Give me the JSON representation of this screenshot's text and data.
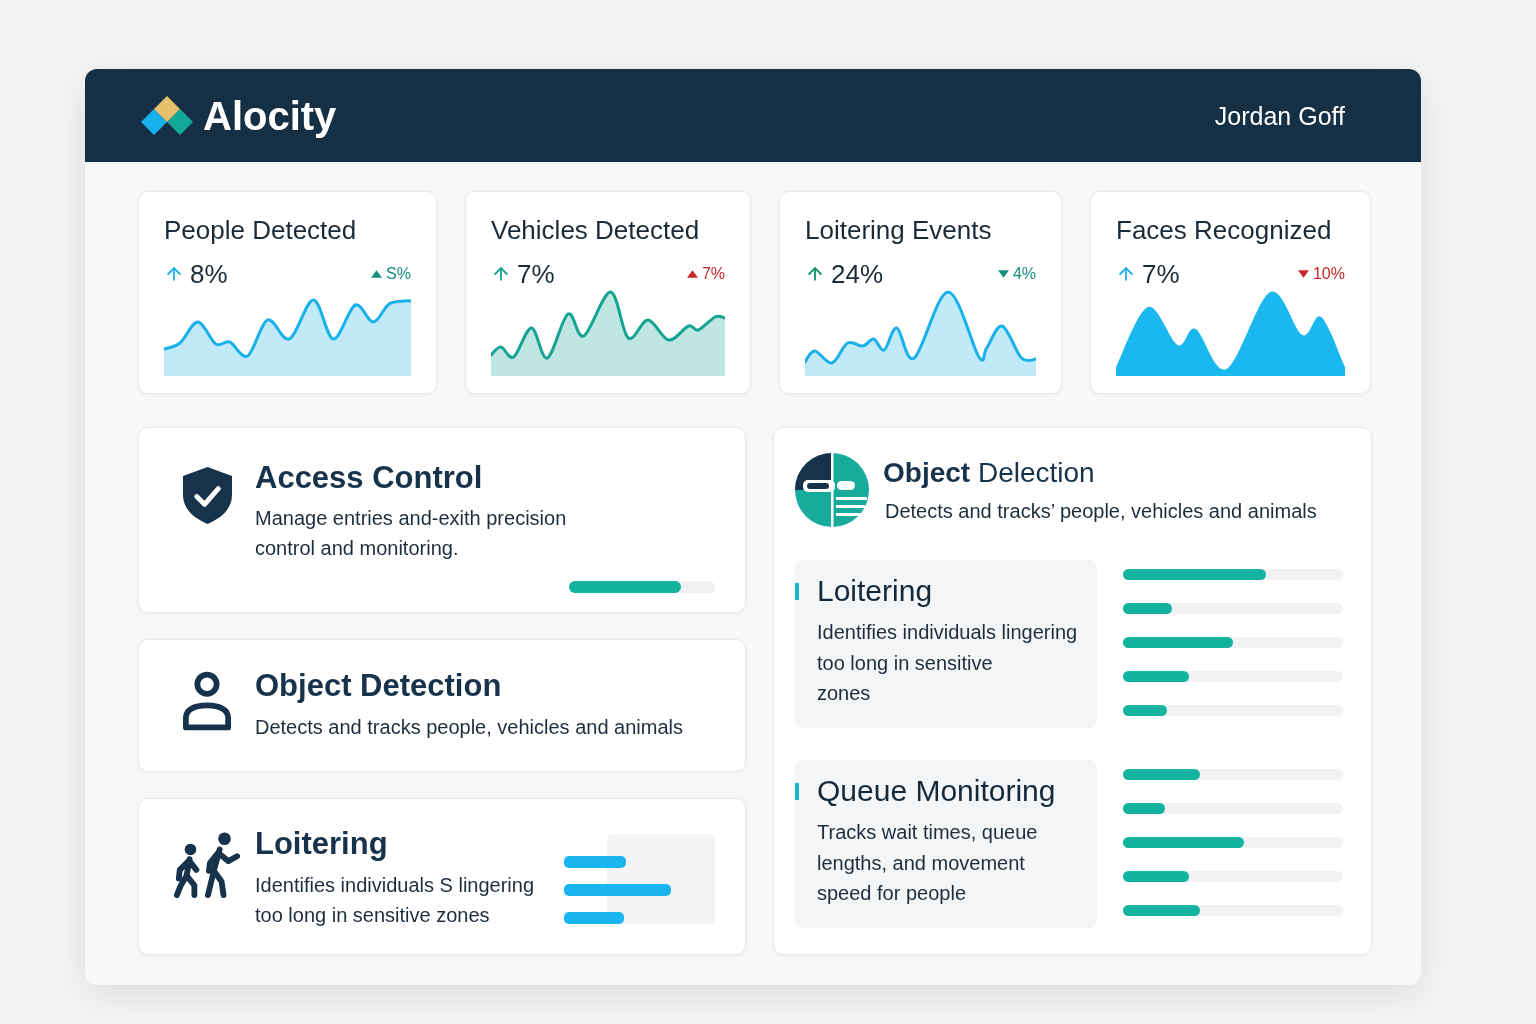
{
  "header": {
    "brand": "Alocity",
    "user_name": "Jordan Goff"
  },
  "stats": [
    {
      "title": "People Detected",
      "trend": {
        "value": "8%",
        "color": "#1ab1ea"
      },
      "change": {
        "text": "S%",
        "rising": true,
        "color": "#138f7e"
      },
      "chart": {
        "kind": "line",
        "color": "#1ab1ea"
      }
    },
    {
      "title": "Vehicles Detected",
      "trend": {
        "value": "7%",
        "color": "#17a392"
      },
      "change": {
        "text": "7%",
        "rising": true,
        "color": "#c62828"
      },
      "chart": {
        "kind": "line",
        "color": "#17a392"
      }
    },
    {
      "title": "Loitering Events",
      "trend": {
        "value": "24%",
        "color": "#138f6f"
      },
      "change": {
        "text": "4%",
        "rising": false,
        "color": "#138f7e"
      },
      "chart": {
        "kind": "line",
        "color": "#1ab1ea"
      }
    },
    {
      "title": "Faces Recognized",
      "trend": {
        "value": "7%",
        "color": "#1ab1ea"
      },
      "change": {
        "text": "10%",
        "rising": false,
        "color": "#c62828"
      },
      "chart": {
        "kind": "solid",
        "color": "#1bb8ef"
      }
    }
  ],
  "features": [
    {
      "kind": "progress",
      "title": "Access Control",
      "description": "Manage entries and-exith precision\ncontrol and monitoring.",
      "level": 0.77
    },
    {
      "kind": "plain",
      "title": "Object Detection",
      "description": "Detects and tracks people, vehicles and animals"
    },
    {
      "kind": "chart",
      "title": "Loitering",
      "description": "Identifies individuals S lingering\ntoo long in sensitive zones"
    }
  ],
  "detail": {
    "title": "**Object** Delection",
    "description": "Detects and tracks’ people, vehicles and animals",
    "sections": [
      {
        "title": "Loitering",
        "description": "Identifies individuals lingering\ntoo long in sensitive\nzones",
        "bars": [
          {
            "level": 0.65
          },
          {
            "level": 0.22
          },
          {
            "level": 0.5
          },
          {
            "level": 0.3
          },
          {
            "level": 0.2
          }
        ]
      },
      {
        "title": "Queue Monitoring",
        "description": "Tracks wait times, queue\nlengths, and movement\nspeed for people",
        "bars": [
          {
            "level": 0.35
          },
          {
            "level": 0.19
          },
          {
            "level": 0.55
          },
          {
            "level": 0.3
          },
          {
            "level": 0.35
          }
        ]
      }
    ]
  }
}
